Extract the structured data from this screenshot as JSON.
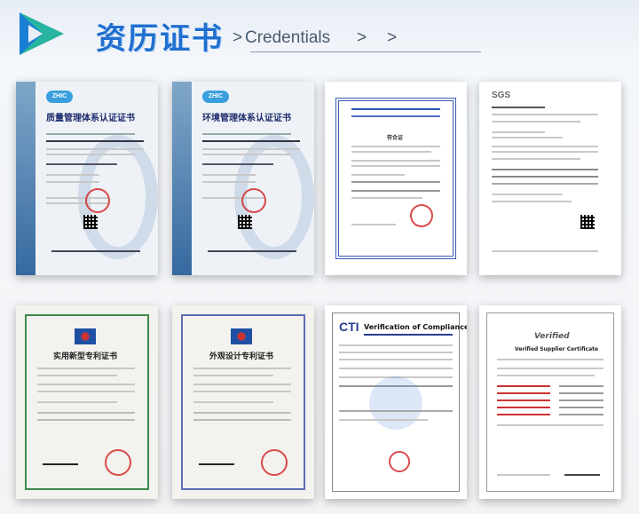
{
  "header": {
    "title_cn": "资历证书",
    "title_en": "Credentials",
    "arrows": [
      ">",
      ">",
      ">"
    ]
  },
  "certificates": [
    {
      "name": "质量管理体系认证证书",
      "brand": "ZHIC"
    },
    {
      "name": "环境管理体系认证证书",
      "brand": "ZHIC"
    },
    {
      "name": "符合证",
      "brand": ""
    },
    {
      "name": "SGS",
      "brand": "SGS"
    },
    {
      "name": "实用新型专利证书",
      "brand": ""
    },
    {
      "name": "外观设计专利证书",
      "brand": ""
    },
    {
      "name": "Verification of Compliance",
      "brand": "CTI"
    },
    {
      "name": "Verified Supplier Certificate",
      "brand": "Verified"
    }
  ],
  "colors": {
    "accent": "#1f6fd0",
    "logo_green": "#27b4a0",
    "seal_red": "#d42b2b"
  }
}
